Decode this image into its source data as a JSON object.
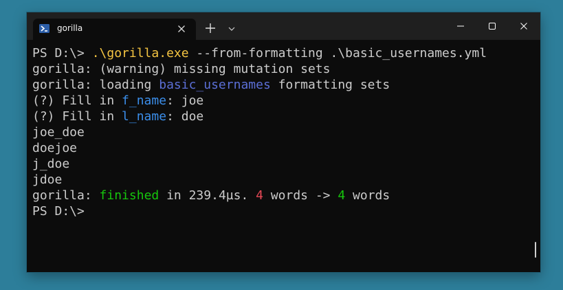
{
  "window": {
    "tab_title": "gorilla",
    "icons": {
      "tab_icon": "powershell-icon",
      "tab_close": "close-icon",
      "new_tab": "plus-icon",
      "dropdown": "chevron-down-icon",
      "minimize": "minimize-icon",
      "maximize": "maximize-icon",
      "close": "close-icon"
    }
  },
  "terminal": {
    "colors": {
      "text": "#cccccc",
      "command": "#f9f1a5",
      "exe": "#f5c542",
      "formatting_set": "#5b6fd6",
      "variable": "#3b8eea",
      "finished": "#16c60c",
      "count_in": "#e74856",
      "count_out": "#16c60c"
    },
    "line1": {
      "prompt": "PS D:\\> ",
      "exe": ".\\gorilla.exe",
      "args": " --from-formatting .\\basic_usernames.yml"
    },
    "line2": "gorilla: (warning) missing mutation sets",
    "line3": {
      "prefix": "gorilla: loading ",
      "set_name": "basic_usernames",
      "suffix": " formatting sets"
    },
    "line4": {
      "prefix": "(?) Fill in ",
      "var": "f_name",
      "suffix": ": joe"
    },
    "line5": {
      "prefix": "(?) Fill in ",
      "var": "l_name",
      "suffix": ": doe"
    },
    "outputs": [
      "joe_doe",
      "doejoe",
      "j_doe",
      "jdoe"
    ],
    "summary": {
      "prefix": "gorilla: ",
      "status": "finished",
      "time": " in 239.4µs. ",
      "count_in": "4",
      "middle": " words -> ",
      "count_out": "4",
      "suffix": " words"
    },
    "final_prompt": "PS D:\\>"
  }
}
